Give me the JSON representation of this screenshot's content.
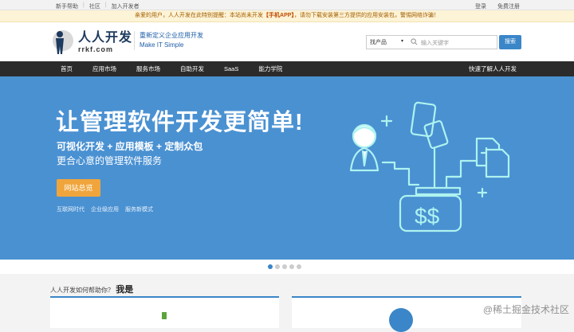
{
  "topbar": {
    "links": [
      "新手帮助",
      "社区",
      "加入开发者"
    ],
    "login": "登录",
    "register": "免费注册"
  },
  "notice": {
    "prefix": "亲爱的用户，人人开发在此特别提醒：本站尚未开发",
    "highlight": "【手机APP】",
    "suffix": "，请勿下载安装第三方提供的应用安装包，警惕网络诈骗！"
  },
  "header": {
    "logo_cn": "人人开发",
    "logo_en": "rrkf.com",
    "slogan_cn": "重新定义企业应用开发",
    "slogan_en": "Make  IT  Simple"
  },
  "search": {
    "category": "找产品",
    "placeholder": "输入关键字",
    "button": "搜索"
  },
  "nav": {
    "items": [
      "首页",
      "应用市场",
      "服务市场",
      "自助开发",
      "SaaS",
      "能力学院"
    ],
    "quick": "快速了解人人开发"
  },
  "hero": {
    "title": "让管理软件开发更简单!",
    "sub1": "可视化开发 + 应用模板 + 定制众包",
    "sub2": "更合心意的管理软件服务",
    "button": "网站总览",
    "tags": [
      "互联网时代",
      "企业级应用",
      "服务新模式"
    ]
  },
  "carousel": {
    "total": 5,
    "active": 1
  },
  "help": {
    "question": "人人开发如何帮助你？",
    "answer": "我是"
  },
  "watermark": "@稀土掘金技术社区",
  "colors": {
    "accent": "#3a86c8",
    "hero": "#4a91d2",
    "nav": "#2b2b2b",
    "button": "#f0a53c"
  }
}
